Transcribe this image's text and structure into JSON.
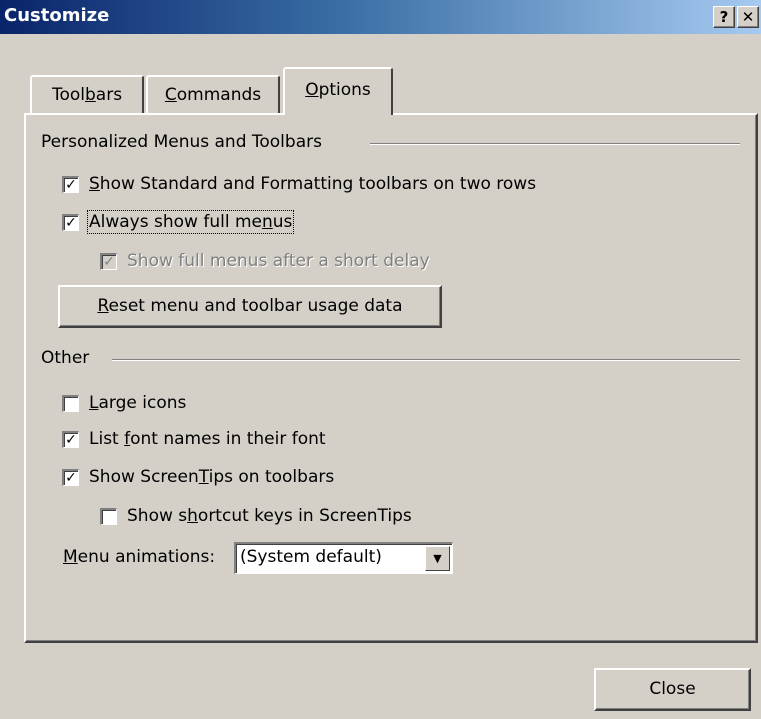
{
  "window": {
    "title": "Customize",
    "help_glyph": "?",
    "close_glyph": "✕"
  },
  "tabs": [
    {
      "label": "Toolbars",
      "pre": "Tool",
      "mn": "b",
      "post": "ars",
      "active": false
    },
    {
      "label": "Commands",
      "pre": "",
      "mn": "C",
      "post": "ommands",
      "active": false
    },
    {
      "label": "Options",
      "pre": "",
      "mn": "O",
      "post": "ptions",
      "active": true
    }
  ],
  "personalized": {
    "title": "Personalized Menus and Toolbars",
    "options": [
      {
        "pre": "",
        "mn": "S",
        "post": "how Standard and Formatting toolbars on two rows",
        "checked": true,
        "mark": "✓"
      },
      {
        "pre": "Always show full me",
        "mn": "n",
        "post": "us",
        "checked": true,
        "mark": "✓"
      },
      {
        "pre": "Show full menus after a short delay",
        "mn": "",
        "post": "",
        "checked": true,
        "disabled": true,
        "mark": "✓"
      }
    ],
    "reset_button": {
      "pre": "",
      "mn": "R",
      "post": "eset menu and toolbar usage data"
    }
  },
  "other": {
    "title": "Other",
    "options": [
      {
        "pre": "",
        "mn": "L",
        "post": "arge icons",
        "checked": false,
        "mark": ""
      },
      {
        "pre": "List ",
        "mn": "f",
        "post": "ont names in their font",
        "checked": true,
        "mark": "✓"
      },
      {
        "pre": "Show Screen",
        "mn": "T",
        "post": "ips on toolbars",
        "checked": true,
        "mark": "✓"
      },
      {
        "pre": "Show s",
        "mn": "h",
        "post": "ortcut keys in ScreenTips",
        "checked": false,
        "mark": ""
      }
    ],
    "menu_animations": {
      "pre": "",
      "mn": "M",
      "post": "enu animations:",
      "value": "(System default)",
      "arrow": "▼"
    }
  },
  "footer": {
    "close_label": "Close"
  }
}
